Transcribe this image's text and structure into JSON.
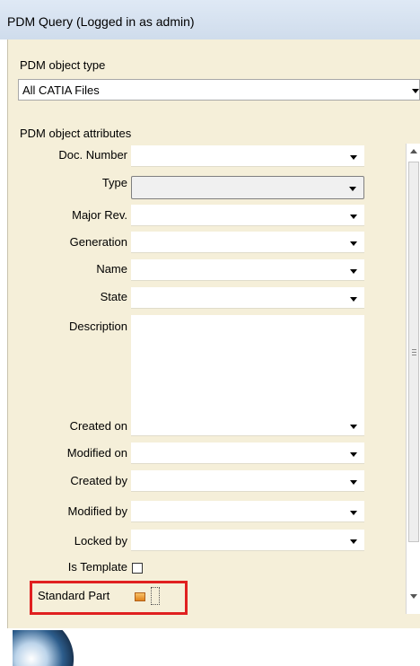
{
  "window": {
    "title": "PDM Query (Logged in as admin)"
  },
  "object_type": {
    "label": "PDM object type",
    "selected": "All CATIA Files"
  },
  "attributes": {
    "label": "PDM object attributes",
    "fields": [
      {
        "label": "Doc. Number",
        "value": ""
      },
      {
        "label": "Type",
        "value": ""
      },
      {
        "label": "Major Rev.",
        "value": ""
      },
      {
        "label": "Generation",
        "value": ""
      },
      {
        "label": "Name",
        "value": ""
      },
      {
        "label": "State",
        "value": ""
      },
      {
        "label": "Description",
        "value": ""
      },
      {
        "label": "Created on",
        "value": ""
      },
      {
        "label": "Modified on",
        "value": ""
      },
      {
        "label": "Created by",
        "value": ""
      },
      {
        "label": "Modified by",
        "value": ""
      },
      {
        "label": "Locked by",
        "value": ""
      },
      {
        "label": "Is Template",
        "checked": false
      },
      {
        "label": "Standard Part",
        "checked": false
      }
    ]
  },
  "colors": {
    "panel_bg": "#f5efd9",
    "highlight": "#e02020"
  },
  "icons": {
    "dropdown": "chevron-down-icon",
    "standard_part": "orange-part-icon"
  }
}
